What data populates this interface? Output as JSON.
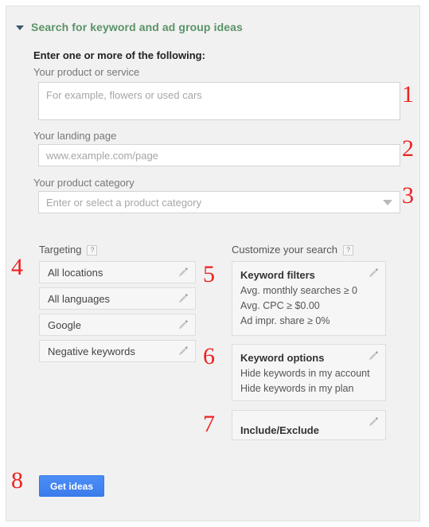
{
  "panel": {
    "title": "Search for keyword and ad group ideas",
    "caret_icon": "caret-down-icon",
    "accent_color": "#5a9367"
  },
  "form": {
    "section_title": "Enter one or more of the following:",
    "product": {
      "label": "Your product or service",
      "placeholder": "For example, flowers or used cars",
      "value": ""
    },
    "landing": {
      "label": "Your landing page",
      "placeholder": "www.example.com/page",
      "value": ""
    },
    "category": {
      "label": "Your product category",
      "placeholder": "Enter or select a product category",
      "value": "",
      "arrow_icon": "chevron-down-icon"
    }
  },
  "targeting": {
    "heading": "Targeting",
    "help_icon": "help-icon",
    "help_label": "?",
    "items": [
      {
        "label": "All locations",
        "edit_icon": "pencil-icon"
      },
      {
        "label": "All languages",
        "edit_icon": "pencil-icon"
      },
      {
        "label": "Google",
        "edit_icon": "pencil-icon"
      },
      {
        "label": "Negative keywords",
        "edit_icon": "pencil-icon"
      }
    ]
  },
  "customize": {
    "heading": "Customize your search",
    "help_icon": "help-icon",
    "help_label": "?",
    "cards": [
      {
        "title": "Keyword filters",
        "edit_icon": "pencil-icon",
        "lines": [
          "Avg. monthly searches ≥ 0",
          "Avg. CPC ≥ $0.00",
          "Ad impr. share ≥ 0%"
        ]
      },
      {
        "title": "Keyword options",
        "edit_icon": "pencil-icon",
        "lines": [
          "Hide keywords in my account",
          "Hide keywords in my plan"
        ]
      },
      {
        "title": "Include/Exclude",
        "edit_icon": "pencil-icon",
        "lines": []
      }
    ]
  },
  "actions": {
    "get_ideas_label": "Get ideas",
    "button_color": "#4285f4"
  },
  "callouts": {
    "color": "#ee2222",
    "n1": "1",
    "n2": "2",
    "n3": "3",
    "n4": "4",
    "n5": "5",
    "n6": "6",
    "n7": "7",
    "n8": "8"
  }
}
